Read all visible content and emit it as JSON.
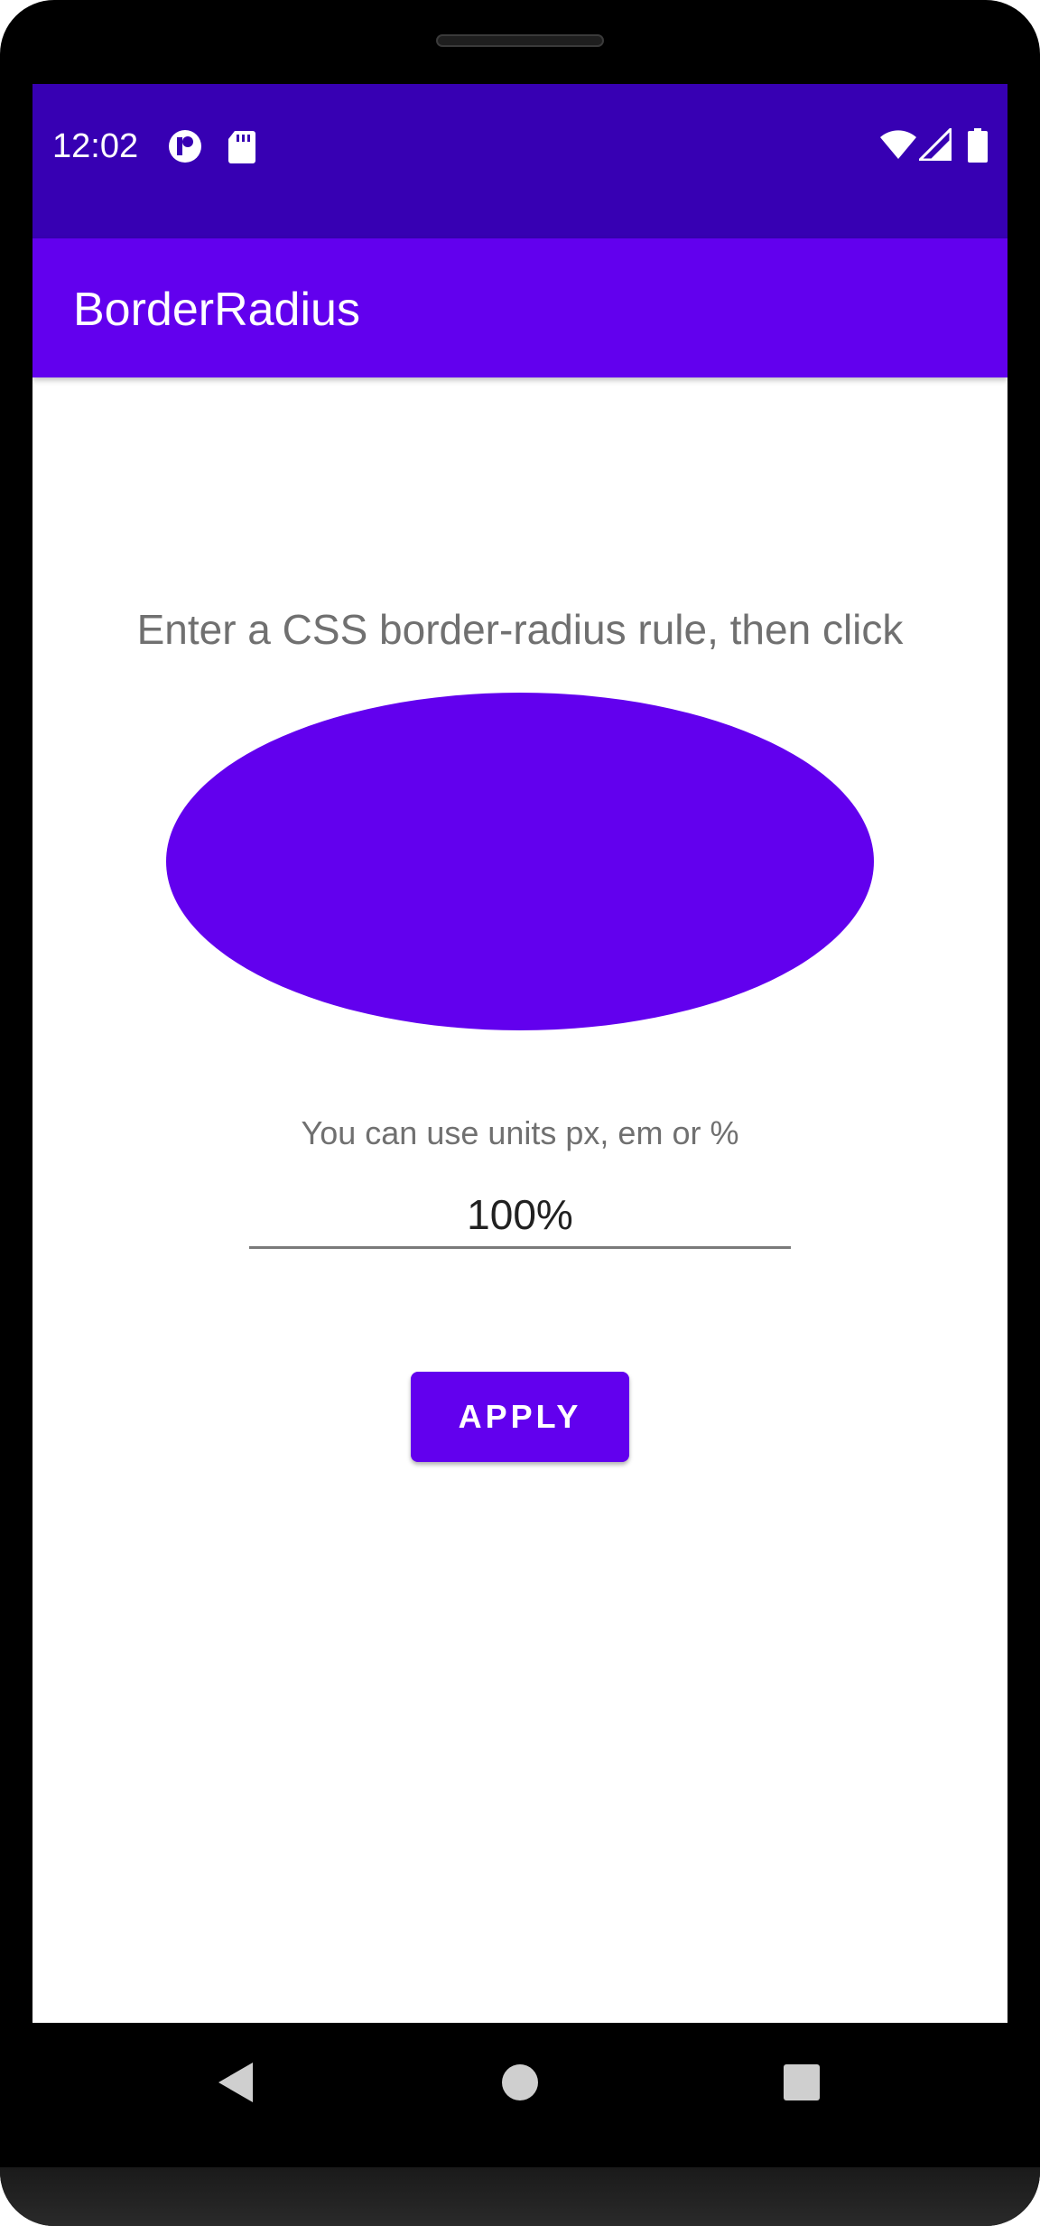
{
  "status_bar": {
    "time": "12:02",
    "left_icons": [
      "circle-dot-icon",
      "sd-card-icon"
    ],
    "right_icons": [
      "wifi-icon",
      "signal-icon",
      "battery-icon"
    ],
    "color": "#3700b3"
  },
  "app_bar": {
    "title": "BorderRadius",
    "color": "#6200ee"
  },
  "main": {
    "instruction": "Enter a CSS border-radius rule, then click",
    "shape_color": "#6200ee",
    "hint": "You can use units px, em or %",
    "input_value": "100%",
    "apply_label": "APPLY"
  },
  "nav_bar": {
    "icons": [
      "back-icon",
      "home-icon",
      "recents-icon"
    ]
  }
}
